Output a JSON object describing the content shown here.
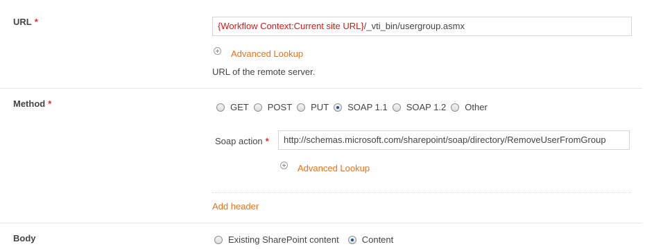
{
  "url_field": {
    "label": "URL",
    "required_mark": "*",
    "value_token": "{Workflow Context:Current site URL}",
    "value_rest": "/_vti_bin/usergroup.asmx",
    "lookup_label": "Advanced Lookup",
    "help_text": "URL of the remote server."
  },
  "method_field": {
    "label": "Method",
    "required_mark": "*",
    "options": [
      "GET",
      "POST",
      "PUT",
      "SOAP 1.1",
      "SOAP 1.2",
      "Other"
    ],
    "selected": "SOAP 1.1",
    "soap_action_label": "Soap action",
    "soap_action_required_mark": "*",
    "soap_action_value": "http://schemas.microsoft.com/sharepoint/soap/directory/RemoveUserFromGroup",
    "lookup_label": "Advanced Lookup",
    "add_header_label": "Add header"
  },
  "body_field": {
    "label": "Body",
    "options": [
      "Existing SharePoint content",
      "Content"
    ],
    "selected": "Content"
  },
  "colors": {
    "accent": "#e8731a",
    "required": "#e22b2b",
    "token": "#d01b1b",
    "radio_selected": "#1e4f86"
  }
}
